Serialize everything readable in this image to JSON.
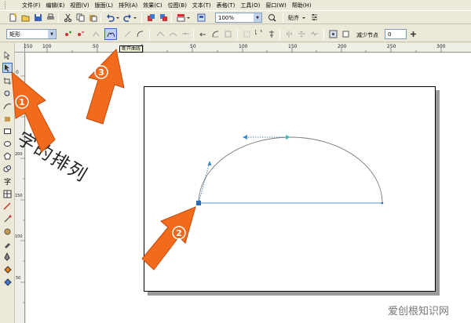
{
  "menubar": {
    "items": [
      "文件(F)",
      "编辑(E)",
      "视图(V)",
      "版面(L)",
      "排列(A)",
      "效果(C)",
      "位图(B)",
      "文本(T)",
      "表格(T)",
      "工具(O)",
      "窗口(W)",
      "帮助(H)"
    ]
  },
  "toolbar": {
    "zoom_value": "100%",
    "snap_label": "贴齐"
  },
  "property_bar": {
    "object_type": "矩形",
    "reduce_nodes_label": "减少节点",
    "reduce_nodes_value": "0"
  },
  "tooltip": {
    "text": "断开曲线"
  },
  "ruler": {
    "h_labels": [
      "150",
      "100",
      "50",
      "0",
      "50",
      "100",
      "150",
      "200",
      "250",
      "300"
    ],
    "v_labels": [
      "0",
      "250",
      "200",
      "150",
      "100",
      "50"
    ]
  },
  "annotations": {
    "markers": [
      "①",
      "②",
      "③"
    ],
    "overlay_text": "字的排列",
    "accent_color": "#f26b1d"
  },
  "watermark": {
    "text": "爱创根知识网"
  },
  "icons": [
    "new-icon",
    "open-icon",
    "save-icon",
    "print-icon",
    "cut-icon",
    "copy-icon",
    "paste-icon",
    "undo-icon",
    "redo-icon",
    "import-icon",
    "export-icon",
    "pick-tool-icon",
    "shape-tool-icon",
    "break-curve-icon"
  ]
}
